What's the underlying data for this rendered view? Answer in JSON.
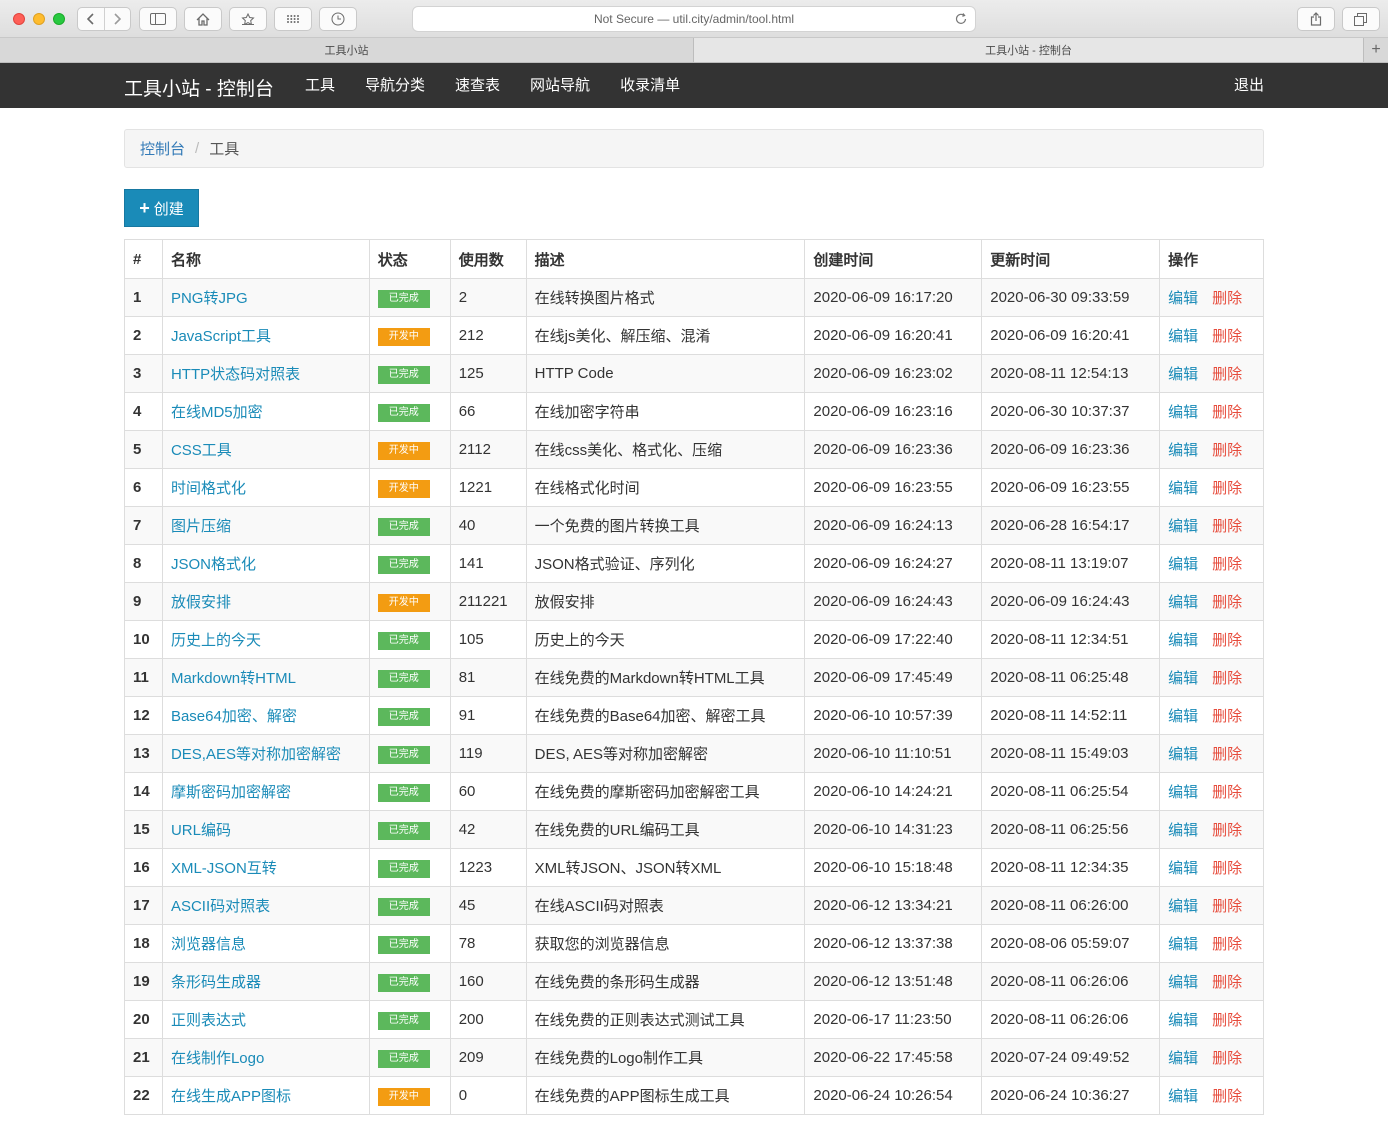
{
  "browser": {
    "address": "Not Secure — util.city/admin/tool.html",
    "tabs": [
      "工具小站",
      "工具小站 - 控制台"
    ],
    "new_tab": "+"
  },
  "navbar": {
    "brand": "工具小站 - 控制台",
    "menu": [
      "工具",
      "导航分类",
      "速查表",
      "网站导航",
      "收录清单"
    ],
    "logout": "退出"
  },
  "breadcrumb": {
    "home": "控制台",
    "sep": "/",
    "current": "工具"
  },
  "create_label": "创建",
  "table": {
    "headers": [
      "#",
      "名称",
      "状态",
      "使用数",
      "描述",
      "创建时间",
      "更新时间",
      "操作"
    ],
    "edit_label": "编辑",
    "delete_label": "删除",
    "rows": [
      {
        "id": "1",
        "name": "PNG转JPG",
        "status": "已完成",
        "count": "2",
        "desc": "在线转换图片格式",
        "created": "2020-06-09 16:17:20",
        "updated": "2020-06-30 09:33:59"
      },
      {
        "id": "2",
        "name": "JavaScript工具",
        "status": "开发中",
        "count": "212",
        "desc": "在线js美化、解压缩、混淆",
        "created": "2020-06-09 16:20:41",
        "updated": "2020-06-09 16:20:41"
      },
      {
        "id": "3",
        "name": "HTTP状态码对照表",
        "status": "已完成",
        "count": "125",
        "desc": "HTTP Code",
        "created": "2020-06-09 16:23:02",
        "updated": "2020-08-11 12:54:13"
      },
      {
        "id": "4",
        "name": "在线MD5加密",
        "status": "已完成",
        "count": "66",
        "desc": "在线加密字符串",
        "created": "2020-06-09 16:23:16",
        "updated": "2020-06-30 10:37:37"
      },
      {
        "id": "5",
        "name": "CSS工具",
        "status": "开发中",
        "count": "2112",
        "desc": "在线css美化、格式化、压缩",
        "created": "2020-06-09 16:23:36",
        "updated": "2020-06-09 16:23:36"
      },
      {
        "id": "6",
        "name": "时间格式化",
        "status": "开发中",
        "count": "1221",
        "desc": "在线格式化时间",
        "created": "2020-06-09 16:23:55",
        "updated": "2020-06-09 16:23:55"
      },
      {
        "id": "7",
        "name": "图片压缩",
        "status": "已完成",
        "count": "40",
        "desc": "一个免费的图片转换工具",
        "created": "2020-06-09 16:24:13",
        "updated": "2020-06-28 16:54:17"
      },
      {
        "id": "8",
        "name": "JSON格式化",
        "status": "已完成",
        "count": "141",
        "desc": "JSON格式验证、序列化",
        "created": "2020-06-09 16:24:27",
        "updated": "2020-08-11 13:19:07"
      },
      {
        "id": "9",
        "name": "放假安排",
        "status": "开发中",
        "count": "211221",
        "desc": "放假安排",
        "created": "2020-06-09 16:24:43",
        "updated": "2020-06-09 16:24:43"
      },
      {
        "id": "10",
        "name": "历史上的今天",
        "status": "已完成",
        "count": "105",
        "desc": "历史上的今天",
        "created": "2020-06-09 17:22:40",
        "updated": "2020-08-11 12:34:51"
      },
      {
        "id": "11",
        "name": "Markdown转HTML",
        "status": "已完成",
        "count": "81",
        "desc": "在线免费的Markdown转HTML工具",
        "created": "2020-06-09 17:45:49",
        "updated": "2020-08-11 06:25:48"
      },
      {
        "id": "12",
        "name": "Base64加密、解密",
        "status": "已完成",
        "count": "91",
        "desc": "在线免费的Base64加密、解密工具",
        "created": "2020-06-10 10:57:39",
        "updated": "2020-08-11 14:52:11"
      },
      {
        "id": "13",
        "name": "DES,AES等对称加密解密",
        "status": "已完成",
        "count": "119",
        "desc": "DES, AES等对称加密解密",
        "created": "2020-06-10 11:10:51",
        "updated": "2020-08-11 15:49:03"
      },
      {
        "id": "14",
        "name": "摩斯密码加密解密",
        "status": "已完成",
        "count": "60",
        "desc": "在线免费的摩斯密码加密解密工具",
        "created": "2020-06-10 14:24:21",
        "updated": "2020-08-11 06:25:54"
      },
      {
        "id": "15",
        "name": "URL编码",
        "status": "已完成",
        "count": "42",
        "desc": "在线免费的URL编码工具",
        "created": "2020-06-10 14:31:23",
        "updated": "2020-08-11 06:25:56"
      },
      {
        "id": "16",
        "name": "XML-JSON互转",
        "status": "已完成",
        "count": "1223",
        "desc": "XML转JSON、JSON转XML",
        "created": "2020-06-10 15:18:48",
        "updated": "2020-08-11 12:34:35"
      },
      {
        "id": "17",
        "name": "ASCII码对照表",
        "status": "已完成",
        "count": "45",
        "desc": "在线ASCII码对照表",
        "created": "2020-06-12 13:34:21",
        "updated": "2020-08-11 06:26:00"
      },
      {
        "id": "18",
        "name": "浏览器信息",
        "status": "已完成",
        "count": "78",
        "desc": "获取您的浏览器信息",
        "created": "2020-06-12 13:37:38",
        "updated": "2020-08-06 05:59:07"
      },
      {
        "id": "19",
        "name": "条形码生成器",
        "status": "已完成",
        "count": "160",
        "desc": "在线免费的条形码生成器",
        "created": "2020-06-12 13:51:48",
        "updated": "2020-08-11 06:26:06"
      },
      {
        "id": "20",
        "name": "正则表达式",
        "status": "已完成",
        "count": "200",
        "desc": "在线免费的正则表达式测试工具",
        "created": "2020-06-17 11:23:50",
        "updated": "2020-08-11 06:26:06"
      },
      {
        "id": "21",
        "name": "在线制作Logo",
        "status": "已完成",
        "count": "209",
        "desc": "在线免费的Logo制作工具",
        "created": "2020-06-22 17:45:58",
        "updated": "2020-07-24 09:49:52"
      },
      {
        "id": "22",
        "name": "在线生成APP图标",
        "status": "开发中",
        "count": "0",
        "desc": "在线免费的APP图标生成工具",
        "created": "2020-06-24 10:26:54",
        "updated": "2020-06-24 10:36:27"
      }
    ]
  },
  "colors": {
    "accent": "#1a8bb8",
    "done": "#5cb85c",
    "dev": "#f39c12",
    "danger": "#e74c3c",
    "navbar": "#333333"
  }
}
